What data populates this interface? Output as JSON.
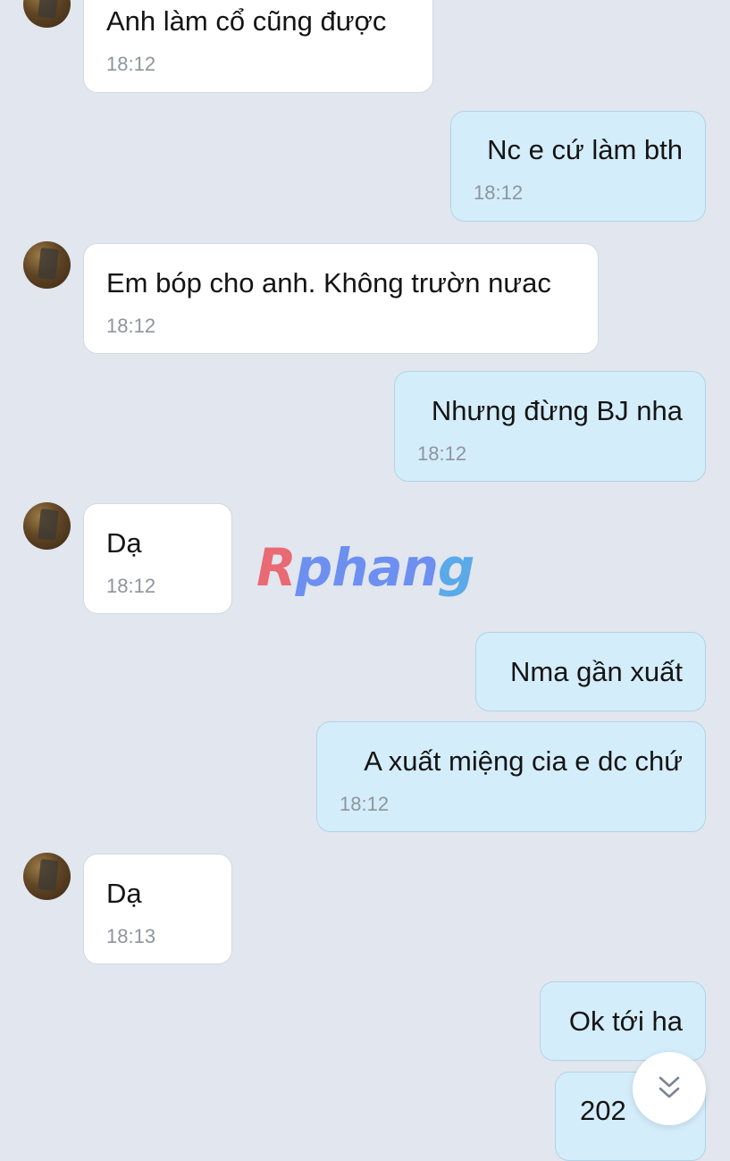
{
  "messages": [
    {
      "direction": "incoming",
      "text": "Anh làm cổ  cũng được",
      "time": "18:12"
    },
    {
      "direction": "outgoing",
      "text": "Nc e cứ làm bth",
      "time": "18:12"
    },
    {
      "direction": "incoming",
      "text": "Em bóp cho anh. Không trườn nưac",
      "time": "18:12"
    },
    {
      "direction": "outgoing",
      "text": "Nhưng đừng BJ nha",
      "time": "18:12"
    },
    {
      "direction": "incoming",
      "text": "Dạ",
      "time": "18:12"
    },
    {
      "direction": "outgoing",
      "text": "Nma gần xuất",
      "time": ""
    },
    {
      "direction": "outgoing",
      "text": "A xuất miệng cia e dc chứ",
      "time": "18:12"
    },
    {
      "direction": "incoming",
      "text": "Dạ",
      "time": "18:13"
    },
    {
      "direction": "outgoing",
      "text": "Ok tới ha",
      "time": ""
    },
    {
      "direction": "outgoing",
      "text": "202",
      "time": ""
    }
  ],
  "watermark": {
    "part1": "R",
    "part2": "phan",
    "part3": "g"
  },
  "scroll_button": {
    "icon": "double-chevron-down-icon"
  },
  "colors": {
    "background": "#e1e6ef",
    "incoming_bubble": "#ffffff",
    "outgoing_bubble": "#d4edfb",
    "timestamp": "#8e959c"
  }
}
